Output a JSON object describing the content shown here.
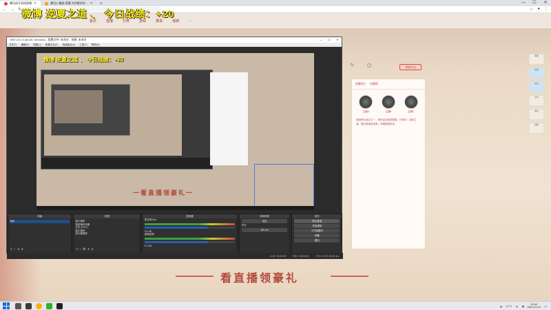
{
  "browser": {
    "tabs": [
      {
        "label": "腾讯虎牙游戏直播",
        "active": true
      },
      {
        "label": "腾讯A-播放·直播 为你更好的…",
        "active": false
      }
    ],
    "url": "",
    "new_tab": "+",
    "window_controls": [
      "—",
      "☐",
      "✕"
    ]
  },
  "site": {
    "overlay_text": "微博 逆夏之道 、 今日战绩：+20",
    "nav": [
      "首页",
      "直播",
      "分类",
      "游戏",
      "赛事",
      "视频",
      "…"
    ],
    "top_icons": [
      "edit-icon",
      "clock-icon"
    ],
    "gift_button": "领取礼包",
    "side_panel": {
      "tabs": [
        "主播排行",
        "贡献榜"
      ],
      "avatar_labels": [
        "主播A",
        "主播B",
        "主播C"
      ],
      "text": "现役职业选手之一，常年征战各类赛事。代表作：逆夏之道。擅长英雄池深厚，风格稳健多变。"
    },
    "right_col": [
      "客服",
      "反馈",
      "关注",
      "分享",
      "电竞",
      "顶部"
    ],
    "banner": "看直播领豪礼"
  },
  "obs": {
    "title": "OBS 24.0.3 (64-bit, windows) - 配置文件: 未命名 - 场景: 未命名",
    "menu": [
      "文件(F)",
      "编辑(E)",
      "视图(V)",
      "配置文件(P)",
      "场景集合(S)",
      "工具(T)",
      "帮助(H)"
    ],
    "preview_overlay": "微博 逆夏之道 、 今日战绩：+20",
    "preview_banner": "一看直播领豪礼一",
    "docks": {
      "scenes": {
        "header": "场景",
        "items": [
          "场景"
        ]
      },
      "sources": {
        "header": "来源",
        "items": [
          "窗口捕获",
          "视频捕获设备",
          "文本 (GDI+)",
          "窗口捕获",
          "显示器捕获"
        ]
      },
      "mixer": {
        "header": "混音器",
        "channels": [
          {
            "name": "麦克风/Aux",
            "db": "0.0 dB"
          },
          {
            "name": "桌面音频",
            "db": "0.0 dB"
          }
        ]
      },
      "transitions": {
        "header": "转场特效",
        "type": "淡出",
        "duration_label": "时长",
        "duration": "300 ms"
      },
      "controls": {
        "header": "控件",
        "buttons": [
          "停止推流",
          "开始录制",
          "工作室模式",
          "设置",
          "退出"
        ]
      }
    },
    "status": [
      "LIVE: 00:00:00",
      "REC: 00:00:00",
      "CPU: 3.2%, 30.00 fps"
    ]
  },
  "taskbar": {
    "weather": "17°C",
    "time": "19:40",
    "date": "2021/11/14"
  }
}
